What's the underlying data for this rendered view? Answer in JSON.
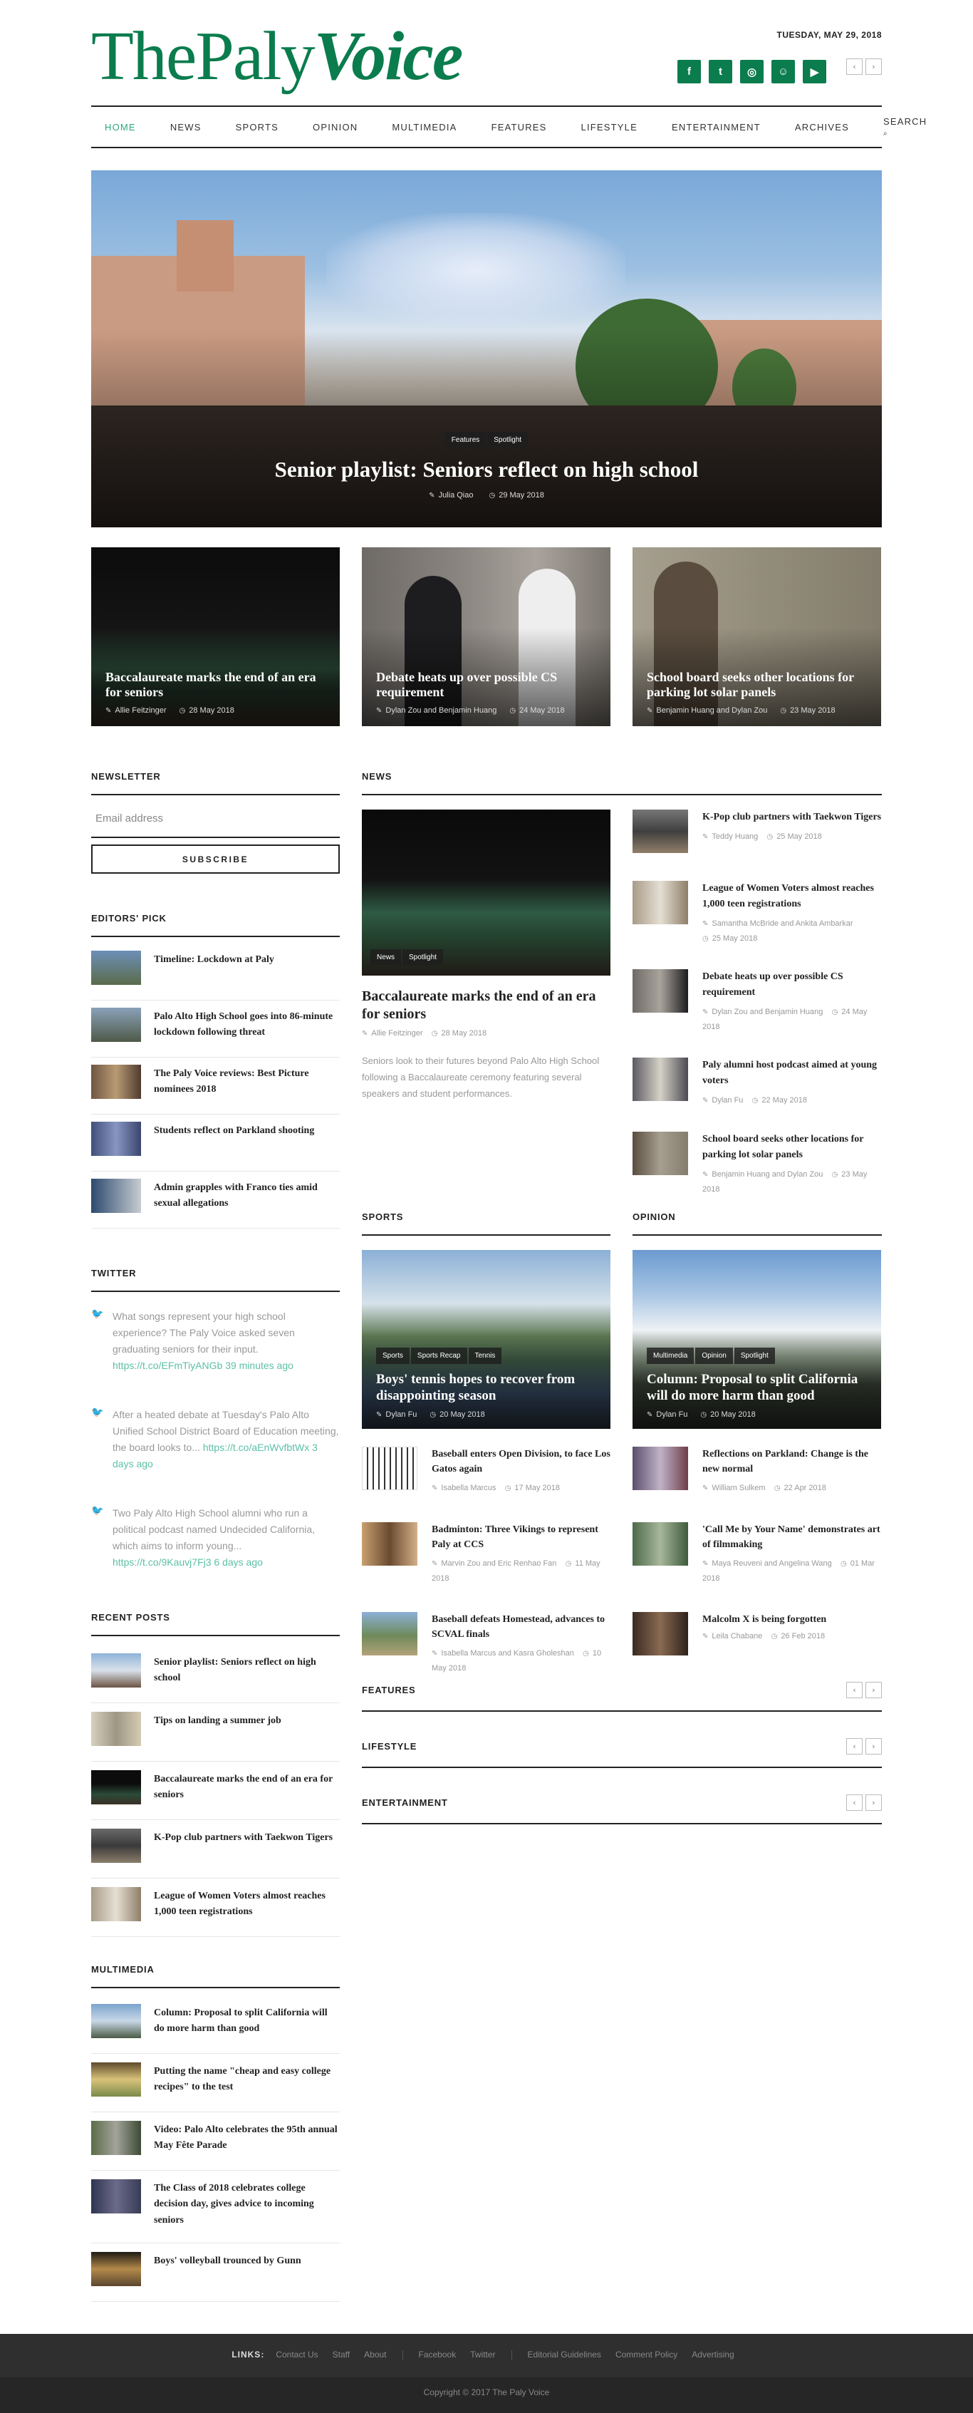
{
  "site": {
    "logo_main": "ThePaly",
    "logo_accent": "Voice",
    "date": "TUESDAY, MAY 29, 2018",
    "social": [
      "facebook-icon",
      "twitter-icon",
      "instagram-icon",
      "snapchat-icon",
      "youtube-icon"
    ],
    "accent_color": "#0b7c4d",
    "link_color": "#5cc0a6"
  },
  "nav": [
    "HOME",
    "NEWS",
    "SPORTS",
    "OPINION",
    "MULTIMEDIA",
    "FEATURES",
    "LIFESTYLE",
    "ENTERTAINMENT",
    "ARCHIVES",
    "SEARCH"
  ],
  "hero": {
    "tags": [
      "Features",
      "Spotlight"
    ],
    "title": "Senior playlist: Seniors reflect on high school",
    "author": "Julia Qiao",
    "date": "29 May 2018"
  },
  "tiles": [
    {
      "title": "Baccalaureate marks the end of an era for seniors",
      "author": "Allie Feitzinger",
      "date": "28 May 2018"
    },
    {
      "title": "Debate heats up over possible CS requirement",
      "author": "Dylan Zou and Benjamin Huang",
      "date": "24 May 2018"
    },
    {
      "title": "School board seeks other locations for parking lot solar panels",
      "author": "Benjamin Huang and Dylan Zou",
      "date": "23 May 2018"
    }
  ],
  "newsletter": {
    "heading": "NEWSLETTER",
    "placeholder": "Email address",
    "button": "SUBSCRIBE"
  },
  "editors_pick": {
    "heading": "EDITORS' PICK",
    "items": [
      "Timeline: Lockdown at Paly",
      "Palo Alto High School goes into 86-minute lockdown following threat",
      "The Paly Voice reviews: Best Picture nominees 2018",
      "Students reflect on Parkland shooting",
      "Admin grapples with Franco ties amid sexual allegations"
    ]
  },
  "twitter": {
    "heading": "TWITTER",
    "tweets": [
      {
        "text": "What songs represent your high school experience? The Paly Voice asked seven graduating seniors for their input. ",
        "link": "https://t.co/EFmTiyANGb",
        "ago": "39 minutes ago"
      },
      {
        "text": "After a heated debate at Tuesday's Palo Alto Unified School District Board of Education meeting, the board looks to... ",
        "link": "https://t.co/aEnWvfbtWx",
        "ago": "3 days ago"
      },
      {
        "text": "Two Paly Alto High School alumni who run a political podcast named Undecided California, which aims to inform young... ",
        "link": "https://t.co/9Kauvj7Fj3",
        "ago": "6 days ago"
      }
    ]
  },
  "recent_posts": {
    "heading": "RECENT POSTS",
    "items": [
      "Senior playlist: Seniors reflect on high school",
      "Tips on landing a summer job",
      "Baccalaureate marks the end of an era for seniors",
      "K-Pop club partners with Taekwon Tigers",
      "League of Women Voters almost reaches 1,000 teen registrations"
    ]
  },
  "multimedia": {
    "heading": "MULTIMEDIA",
    "items": [
      "Column: Proposal to split California will do more harm than good",
      "Putting the name \"cheap and easy college recipes\" to the test",
      "Video: Palo Alto celebrates the 95th annual May Fête Parade",
      "The Class of 2018 celebrates college decision day, gives advice to incoming seniors",
      "Boys' volleyball trounced by Gunn"
    ]
  },
  "news": {
    "heading": "NEWS",
    "lead": {
      "tags": [
        "News",
        "Spotlight"
      ],
      "title": "Baccalaureate marks the end of an era for seniors",
      "author": "Allie Feitzinger",
      "date": "28 May 2018",
      "excerpt": "Seniors look to their futures beyond Palo Alto High School following a Baccalaureate ceremony featuring several speakers and student performances."
    },
    "items": [
      {
        "title": "K-Pop club partners with Taekwon Tigers",
        "author": "Teddy Huang",
        "date": "25 May 2018"
      },
      {
        "title": "League of Women Voters almost reaches 1,000 teen registrations",
        "author": "Samantha McBride and Ankita Ambarkar",
        "date": "25 May 2018"
      },
      {
        "title": "Debate heats up over possible CS requirement",
        "author": "Dylan Zou and Benjamin Huang",
        "date": "24 May 2018"
      },
      {
        "title": "Paly alumni host podcast aimed at young voters",
        "author": "Dylan Fu",
        "date": "22 May 2018"
      },
      {
        "title": "School board seeks other locations for parking lot solar panels",
        "author": "Benjamin Huang and Dylan Zou",
        "date": "23 May 2018"
      }
    ]
  },
  "sports": {
    "heading": "SPORTS",
    "lead": {
      "tags": [
        "Sports",
        "Sports Recap",
        "Tennis"
      ],
      "title": "Boys' tennis hopes to recover from disappointing season",
      "author": "Dylan Fu",
      "date": "20 May 2018"
    },
    "items": [
      {
        "title": "Baseball enters Open Division, to face Los Gatos again",
        "author": "Isabella Marcus",
        "date": "17 May 2018"
      },
      {
        "title": "Badminton: Three Vikings to represent Paly at CCS",
        "author": "Marvin Zou and Eric Renhao Fan",
        "date": "11 May 2018"
      },
      {
        "title": "Baseball defeats Homestead, advances to SCVAL finals",
        "author": "Isabella Marcus and Kasra Gholeshan",
        "date": "10 May 2018"
      }
    ]
  },
  "opinion": {
    "heading": "OPINION",
    "lead": {
      "tags": [
        "Multimedia",
        "Opinion",
        "Spotlight"
      ],
      "title": "Column: Proposal to split California will do more harm than good",
      "author": "Dylan Fu",
      "date": "20 May 2018"
    },
    "items": [
      {
        "title": "Reflections on Parkland: Change is the new normal",
        "author": "William Sulkem",
        "date": "22 Apr 2018"
      },
      {
        "title": "'Call Me by Your Name' demonstrates art of filmmaking",
        "author": "Maya Reuveni and Angelina Wang",
        "date": "01 Mar 2018"
      },
      {
        "title": "Malcolm X is being forgotten",
        "author": "Leila Chabane",
        "date": "26 Feb 2018"
      }
    ]
  },
  "sections": [
    "FEATURES",
    "LIFESTYLE",
    "ENTERTAINMENT"
  ],
  "footer": {
    "label": "LINKS:",
    "group1": [
      "Contact Us",
      "Staff",
      "About"
    ],
    "group2": [
      "Facebook",
      "Twitter"
    ],
    "group3": [
      "Editorial Guidelines",
      "Comment Policy",
      "Advertising"
    ],
    "copyright": "Copyright © 2017 The Paly Voice"
  }
}
